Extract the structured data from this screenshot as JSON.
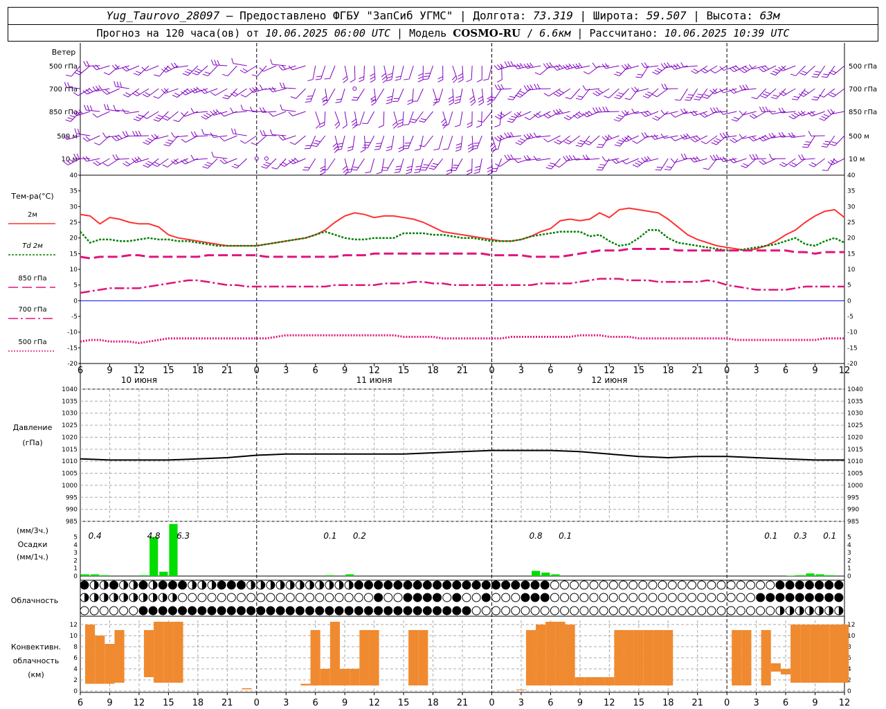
{
  "header": {
    "station": "Yug_Taurovo_28097",
    "provided_by": "Предоставлено ФГБУ \"ЗапСиб УГМС\"",
    "lon_label": "Долгота:",
    "lon": "73.319",
    "lat_label": "Широта:",
    "lat": "59.507",
    "alt_label": "Высота:",
    "alt": "63м",
    "forecast_label": "Прогноз на 120 часа(ов) от",
    "forecast_from": "10.06.2025 06:00 UTC",
    "model_label": "Модель",
    "model": "COSMO-RU",
    "resolution": "6.6км",
    "computed_label": "Рассчитано:",
    "computed": "10.06.2025 10:39 UTC"
  },
  "panels": {
    "wind": {
      "title": "Ветер",
      "levels": [
        "500 гПа",
        "700 гПа",
        "850 гПа",
        "500 м",
        "10  м"
      ],
      "color": "#8000c0"
    },
    "temperature": {
      "title": "Тем-ра(°C)",
      "legend": [
        "2м",
        "Td  2м",
        "850 гПа",
        "700 гПа",
        "500 гПа"
      ]
    },
    "pressure": {
      "title_line1": "Давление",
      "title_line2": "(гПа)"
    },
    "precip": {
      "title_top": "(мм/3ч.)",
      "title": "Осадки",
      "title_bottom": "(мм/1ч.)"
    },
    "cloud": {
      "title": "Облачность"
    },
    "convective": {
      "title_line1": "Конвективн.",
      "title_line2": "облачность",
      "title_line3": "(км)"
    }
  },
  "time_axis": {
    "hour_labels": [
      "6",
      "9",
      "12",
      "15",
      "18",
      "21",
      "0",
      "3",
      "6",
      "9",
      "12",
      "15",
      "18",
      "21",
      "0",
      "3",
      "6",
      "9",
      "12",
      "15",
      "18",
      "21",
      "0",
      "3",
      "6",
      "9",
      "12"
    ],
    "days": [
      "10 июня",
      "11 июня",
      "12 июня"
    ]
  },
  "colors": {
    "t2m": "#ff3030",
    "td2m": "#008000",
    "t850": "#e0147c",
    "t700": "#e0147c",
    "t500": "#e0147c",
    "zero_line": "#0000ff",
    "pressure": "#000000",
    "precip": "#00dd00",
    "convective": "#f08a30"
  },
  "chart_data": [
    {
      "type": "line",
      "title": "Тем-ра(°C)",
      "x_unit": "hours from 10.06.2025 06:00 UTC",
      "ylim": [
        -20,
        40
      ],
      "x": [
        0,
        1,
        2,
        3,
        4,
        5,
        6,
        7,
        8,
        9,
        10,
        11,
        12,
        13,
        14,
        15,
        16,
        17,
        18,
        19,
        20,
        21,
        22,
        23,
        24,
        25,
        26,
        27,
        28,
        29,
        30,
        31,
        32,
        33,
        34,
        35,
        36,
        37,
        38,
        39,
        40,
        41,
        42,
        43,
        44,
        45,
        46,
        47,
        48,
        49,
        50,
        51,
        52,
        53,
        54,
        55,
        56,
        57,
        58,
        59,
        60,
        61,
        62,
        63,
        64,
        65,
        66,
        67,
        68,
        69,
        70,
        71,
        72,
        73,
        74,
        75,
        76,
        77,
        78
      ],
      "series": [
        {
          "name": "2м",
          "values": [
            27.5,
            27,
            24.5,
            26.5,
            26,
            25,
            24.5,
            24.5,
            23.5,
            21,
            20,
            19.5,
            19,
            18.5,
            18,
            17.5,
            17.5,
            17.5,
            17.5,
            18,
            18.5,
            19,
            19.5,
            20,
            21,
            22.5,
            25,
            27,
            28,
            27.5,
            26.5,
            27,
            27,
            26.5,
            26,
            25,
            23.5,
            22,
            21.5,
            21,
            20.5,
            20,
            19.5,
            19,
            19,
            19.5,
            20.5,
            22,
            23,
            25.5,
            26,
            25.5,
            26,
            28,
            26.5,
            29,
            29.5,
            29,
            28.5,
            28,
            26,
            23.5,
            21,
            19.5,
            18.5,
            17.5,
            17,
            16.5,
            16,
            16.5,
            17.5,
            19,
            21,
            22.5,
            25,
            27,
            28.5,
            29,
            26.5
          ]
        },
        {
          "name": "Td  2м",
          "values": [
            22,
            18.5,
            19.5,
            19.5,
            19,
            19,
            19.5,
            20,
            19.5,
            19.5,
            19,
            19,
            18.5,
            18,
            17.5,
            17.5,
            17.5,
            17.5,
            17.5,
            18,
            18.5,
            19,
            19.5,
            20,
            21,
            22,
            21,
            20,
            19.5,
            19.5,
            20,
            20,
            20,
            21.5,
            21.5,
            21.5,
            21,
            21,
            20.5,
            20,
            20,
            19.5,
            19,
            19,
            19,
            19.5,
            20.5,
            21,
            21.5,
            22,
            22,
            22,
            20.5,
            21,
            19,
            17.5,
            18,
            20,
            22.5,
            22.5,
            20,
            18.5,
            18,
            17.5,
            17,
            16.5,
            16,
            16,
            16.5,
            17,
            17.5,
            18,
            19,
            20,
            18,
            17.5,
            19,
            20,
            18.5
          ]
        },
        {
          "name": "850 гПа",
          "values": [
            14,
            13.5,
            14,
            14,
            14,
            14.5,
            14.5,
            14,
            14,
            14,
            14,
            14,
            14,
            14.5,
            14.5,
            14.5,
            14.5,
            14.5,
            14.5,
            14,
            14,
            14,
            14,
            14,
            14,
            14,
            14,
            14.5,
            14.5,
            14.5,
            15,
            15,
            15,
            15,
            15,
            15,
            15,
            15,
            15,
            15,
            15,
            15,
            14.5,
            14.5,
            14.5,
            14.5,
            14,
            14,
            14,
            14,
            14.5,
            15,
            15.5,
            16,
            16,
            16,
            16.5,
            16.5,
            16.5,
            16.5,
            16.5,
            16,
            16,
            16,
            16,
            16,
            16,
            16,
            16,
            16,
            16,
            16,
            16,
            15.5,
            15.5,
            15,
            15.5,
            15.5,
            15.5
          ]
        },
        {
          "name": "700 гПа",
          "values": [
            2.5,
            3,
            3.5,
            4,
            4,
            4,
            4,
            4.5,
            5,
            5.5,
            6,
            6.5,
            6.5,
            6,
            5.5,
            5,
            5,
            4.5,
            4.5,
            4.5,
            4.5,
            4.5,
            4.5,
            4.5,
            4.5,
            4.5,
            5,
            5,
            5,
            5,
            5,
            5.5,
            5.5,
            5.5,
            6,
            6,
            5.5,
            5.5,
            5,
            5,
            5,
            5,
            5,
            5,
            5,
            5,
            5,
            5.5,
            5.5,
            5.5,
            5.5,
            6,
            6.5,
            7,
            7,
            7,
            6.5,
            6.5,
            6.5,
            6,
            6,
            6,
            6,
            6,
            6.5,
            6,
            5,
            4.5,
            4,
            3.5,
            3.5,
            3.5,
            3.5,
            4,
            4.5,
            4.5,
            4.5,
            4.5,
            4.5
          ]
        },
        {
          "name": "500 гПа",
          "values": [
            -13,
            -12.5,
            -12.5,
            -13,
            -13,
            -13,
            -13.5,
            -13,
            -12.5,
            -12,
            -12,
            -12,
            -12,
            -12,
            -12,
            -12,
            -12,
            -12,
            -12,
            -12,
            -11.5,
            -11,
            -11,
            -11,
            -11,
            -11,
            -11,
            -11,
            -11,
            -11,
            -11,
            -11,
            -11,
            -11.5,
            -11.5,
            -11.5,
            -11.5,
            -12,
            -12,
            -12,
            -12,
            -12,
            -12,
            -12,
            -11.5,
            -11.5,
            -11.5,
            -11.5,
            -11.5,
            -11.5,
            -11.5,
            -11,
            -11,
            -11,
            -11.5,
            -11.5,
            -11.5,
            -12,
            -12,
            -12,
            -12,
            -12,
            -12,
            -12,
            -12,
            -12,
            -12,
            -12.5,
            -12.5,
            -12.5,
            -12.5,
            -12.5,
            -12.5,
            -12.5,
            -12.5,
            -12.5,
            -12,
            -12,
            -12
          ]
        }
      ]
    },
    {
      "type": "line",
      "title": "Давление",
      "ylabel": "(гПа)",
      "ylim": [
        985,
        1040
      ],
      "x": [
        0,
        3,
        6,
        9,
        12,
        15,
        18,
        21,
        24,
        27,
        30,
        33,
        36,
        39,
        42,
        45,
        48,
        51,
        54,
        57,
        60,
        63,
        66,
        69,
        72,
        75,
        78
      ],
      "series": [
        {
          "name": "Давление",
          "values": [
            1011,
            1010.5,
            1010.5,
            1010.5,
            1011,
            1011.5,
            1012.5,
            1013,
            1013,
            1013,
            1013,
            1013,
            1013.5,
            1014,
            1014.5,
            1014.5,
            1014.5,
            1014,
            1013,
            1012,
            1011.5,
            1012,
            1012,
            1011.5,
            1011,
            1010.5,
            1010.5
          ]
        }
      ]
    },
    {
      "type": "bar",
      "title": "Осадки",
      "ylabel": "(мм/3ч.) / (мм/1ч.)",
      "ylim": [
        0,
        5
      ],
      "x": [
        0,
        1,
        2,
        6,
        7,
        8,
        9,
        25,
        27,
        46,
        47,
        48,
        72,
        73,
        74,
        75,
        76
      ],
      "values": [
        0.2,
        0.2,
        0.1,
        0.1,
        4.5,
        0.5,
        6,
        0.1,
        0.2,
        0.6,
        0.4,
        0.2,
        0.05,
        0.1,
        0.3,
        0.2,
        0.1
      ],
      "labels": [
        {
          "x": 1.5,
          "text": "0.4"
        },
        {
          "x": 7.5,
          "text": "4.8"
        },
        {
          "x": 10.5,
          "text": "6.3"
        },
        {
          "x": 25.5,
          "text": "0.1"
        },
        {
          "x": 28.5,
          "text": "0.2"
        },
        {
          "x": 46.5,
          "text": "0.8"
        },
        {
          "x": 49.5,
          "text": "0.1"
        },
        {
          "x": 70.5,
          "text": "0.1"
        },
        {
          "x": 73.5,
          "text": "0.3"
        },
        {
          "x": 76.5,
          "text": "0.1"
        }
      ]
    },
    {
      "type": "bar",
      "title": "Конвективн. облачность",
      "ylabel": "(км)",
      "ylim": [
        0,
        13
      ],
      "x": [
        0,
        1,
        2,
        3,
        6,
        7,
        8,
        9,
        16,
        22,
        23,
        24,
        25,
        26,
        27,
        28,
        29,
        33,
        34,
        44,
        45,
        46,
        47,
        48,
        49,
        50,
        51,
        52,
        53,
        54,
        55,
        56,
        57,
        58,
        59,
        66,
        67,
        69,
        70,
        71,
        72,
        73,
        74,
        75,
        76,
        77,
        78
      ],
      "values": [
        [
          1.3,
          12
        ],
        [
          1.3,
          10
        ],
        [
          1.3,
          8.5
        ],
        [
          1.5,
          11
        ],
        [
          2.5,
          11
        ],
        [
          1.5,
          12.5
        ],
        [
          1.5,
          12.5
        ],
        [
          1.5,
          12.5
        ],
        [
          0.3,
          0.5
        ],
        [
          1,
          1.3
        ],
        [
          1,
          11
        ],
        [
          1,
          4
        ],
        [
          1,
          12.5
        ],
        [
          1,
          4
        ],
        [
          1,
          4
        ],
        [
          1,
          11
        ],
        [
          1,
          11
        ],
        [
          1,
          11
        ],
        [
          1,
          11
        ],
        [
          0.2,
          0.3
        ],
        [
          1,
          11
        ],
        [
          1,
          12
        ],
        [
          1,
          12.5
        ],
        [
          1,
          12.5
        ],
        [
          1,
          12
        ],
        [
          1,
          2.5
        ],
        [
          1,
          2.5
        ],
        [
          1,
          2.5
        ],
        [
          1,
          2.5
        ],
        [
          1,
          11
        ],
        [
          1,
          11
        ],
        [
          1,
          11
        ],
        [
          1,
          11
        ],
        [
          1,
          11
        ],
        [
          1,
          11
        ],
        [
          1,
          11
        ],
        [
          1,
          11
        ],
        [
          1,
          11
        ],
        [
          3.5,
          5
        ],
        [
          3,
          4
        ],
        [
          1.5,
          12
        ],
        [
          1.5,
          12
        ],
        [
          1.5,
          12
        ],
        [
          1.5,
          12
        ],
        [
          1.5,
          12
        ],
        [
          1.5,
          12
        ],
        [
          3,
          12
        ]
      ]
    }
  ]
}
